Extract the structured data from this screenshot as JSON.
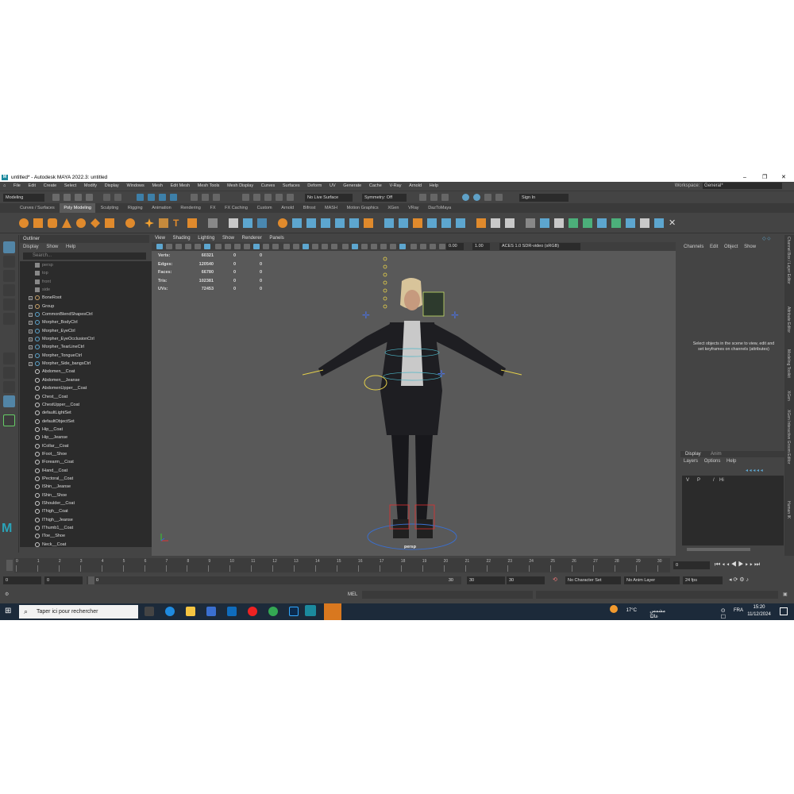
{
  "window": {
    "title": "untitled* - Autodesk MAYA 2022.3: untitled",
    "controls": [
      "–",
      "❐",
      "✕"
    ]
  },
  "menubar": {
    "items": [
      "File",
      "Edit",
      "Create",
      "Select",
      "Modify",
      "Display",
      "Windows",
      "Mesh",
      "Edit Mesh",
      "Mesh Tools",
      "Mesh Display",
      "Curves",
      "Surfaces",
      "Deform",
      "UV",
      "Generate",
      "Cache",
      "V-Ray",
      "Arnold",
      "Help"
    ],
    "workspace_label": "Workspace:",
    "workspace_value": "General*"
  },
  "statusline": {
    "mode": "Modeling",
    "live_surface": "No Live Surface",
    "symmetry": "Symmetry: Off",
    "sign_in": "Sign In"
  },
  "shelf": {
    "tabs": [
      "Curves / Surfaces",
      "Poly Modeling",
      "Sculpting",
      "Rigging",
      "Animation",
      "Rendering",
      "FX",
      "FX Caching",
      "Custom",
      "Arnold",
      "Bifrost",
      "MASH",
      "Motion Graphics",
      "XGen",
      "VRay",
      "DazToMaya"
    ],
    "active_tab": "Poly Modeling"
  },
  "outliner": {
    "title": "Outliner",
    "menu": [
      "Display",
      "Show",
      "Help"
    ],
    "search_placeholder": "Search...",
    "cameras": [
      "persp",
      "top",
      "front",
      "side"
    ],
    "groups": [
      "BoneRoot",
      "Group",
      "CommonBlendShapesCtrl",
      "Morpher_BodyCtrl",
      "Morpher_EyeCtrl",
      "Morpher_EyeOcclusionCtrl",
      "Morpher_TearLineCtrl",
      "Morpher_TongueCtrl",
      "Morpher_Side_bangsCtrl"
    ],
    "sets": [
      "Abdomen__Coat",
      "Abdomen__Jeanse",
      "AbdomenUpper__Coat",
      "Chest__Coat",
      "ChestUpper__Coat",
      "defaultLightSet",
      "defaultObjectSet",
      "Hip__Coat",
      "Hip__Jeanse",
      "lCollar__Coat",
      "lFoot__Shoe",
      "lForearm__Coat",
      "lHand__Coat",
      "lPectoral__Coat",
      "lShin__Jeanse",
      "lShin__Shoe",
      "lShoulder__Coat",
      "lThigh__Coat",
      "lThigh__Jeanse",
      "lThumb1__Coat",
      "lToe__Shoe",
      "Neck__Coat"
    ]
  },
  "viewport": {
    "menu": [
      "View",
      "Shading",
      "Lighting",
      "Show",
      "Renderer",
      "Panels"
    ],
    "exposure": "0.00",
    "gamma": "1.00",
    "color_space": "ACES 1.0 SDR-video (sRGB)",
    "camera_label": "persp",
    "hud": [
      {
        "label": "Verts:",
        "a": "60321",
        "b": "0",
        "c": "0"
      },
      {
        "label": "Edges:",
        "a": "120540",
        "b": "0",
        "c": "0"
      },
      {
        "label": "Faces:",
        "a": "66780",
        "b": "0",
        "c": "0"
      },
      {
        "label": "Tris:",
        "a": "102381",
        "b": "0",
        "c": "0"
      },
      {
        "label": "UVs:",
        "a": "72453",
        "b": "0",
        "c": "0"
      }
    ]
  },
  "channels": {
    "menu": [
      "Channels",
      "Edit",
      "Object",
      "Show"
    ],
    "message": "Select objects in the scene to view, edit and set keyframes on channels (attributes)"
  },
  "layers": {
    "tabs": [
      "Display",
      "Anim"
    ],
    "menu": [
      "Layers",
      "Options",
      "Help"
    ],
    "row": [
      "V",
      "P",
      "/",
      "Hi"
    ]
  },
  "side_tabs": [
    "Channel Box / Layer Editor",
    "Attribute Editor",
    "Modeling Toolkit",
    "XGen",
    "XGen Interactive Groom Editor",
    "Human IK"
  ],
  "timeline": {
    "ticks": [
      "0",
      "1",
      "2",
      "3",
      "4",
      "5",
      "6",
      "7",
      "8",
      "9",
      "10",
      "11",
      "12",
      "13",
      "14",
      "15",
      "16",
      "17",
      "18",
      "19",
      "20",
      "21",
      "22",
      "23",
      "24",
      "25",
      "26",
      "27",
      "28",
      "29",
      "30"
    ],
    "current_frame": "0"
  },
  "range": {
    "start": "0",
    "anim_start": "0",
    "slider_start": "0",
    "slider_end": "30",
    "end": "30",
    "anim_end": "30",
    "character_set": "No Character Set",
    "anim_layer": "No Anim Layer",
    "fps": "24 fps"
  },
  "cmdline": {
    "label": "MEL"
  },
  "taskbar": {
    "search_placeholder": "Taper ici pour rechercher",
    "weather": "17°C",
    "weather_text": "مشمس غالبًا",
    "language": "FRA",
    "time": "15:20",
    "date": "11/12/2024"
  }
}
